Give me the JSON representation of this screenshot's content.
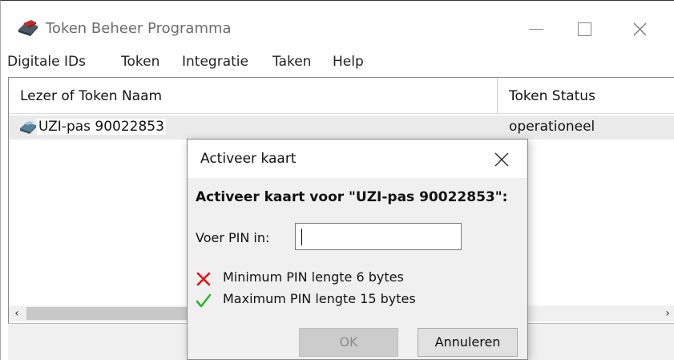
{
  "window": {
    "title": "Token Beheer Programma",
    "icons": {
      "app": "token-reader-icon",
      "minimize": "minimize-icon",
      "maximize": "maximize-icon",
      "close": "close-icon"
    }
  },
  "menu": {
    "items": [
      {
        "label": "Digitale IDs"
      },
      {
        "label": "Token"
      },
      {
        "label": "Integratie"
      },
      {
        "label": "Taken"
      },
      {
        "label": "Help"
      }
    ]
  },
  "table": {
    "columns": [
      {
        "label": "Lezer of Token Naam"
      },
      {
        "label": "Token Status"
      }
    ],
    "rows": [
      {
        "name": "UZI-pas 90022853",
        "status": "operationeel",
        "icon": "smartcard-reader-icon"
      }
    ]
  },
  "scrollbar": {
    "left_arrow": "‹",
    "right_arrow": "›"
  },
  "dialog": {
    "title": "Activeer kaart",
    "heading": "Activeer kaart voor \"UZI-pas 90022853\":",
    "pin_label": "Voer PIN in:",
    "pin_value": "",
    "rules": [
      {
        "text": "Minimum PIN lengte 6 bytes",
        "met": false,
        "icon": "red-cross-icon"
      },
      {
        "text": "Maximum PIN lengte 15 bytes",
        "met": true,
        "icon": "green-check-icon"
      }
    ],
    "ok_label": "OK",
    "cancel_label": "Annuleren"
  },
  "colors": {
    "cross": "#e0141e",
    "check": "#2fb52f",
    "row_highlight": "#eaeaea",
    "dialog_bg": "#f0f0f0"
  }
}
